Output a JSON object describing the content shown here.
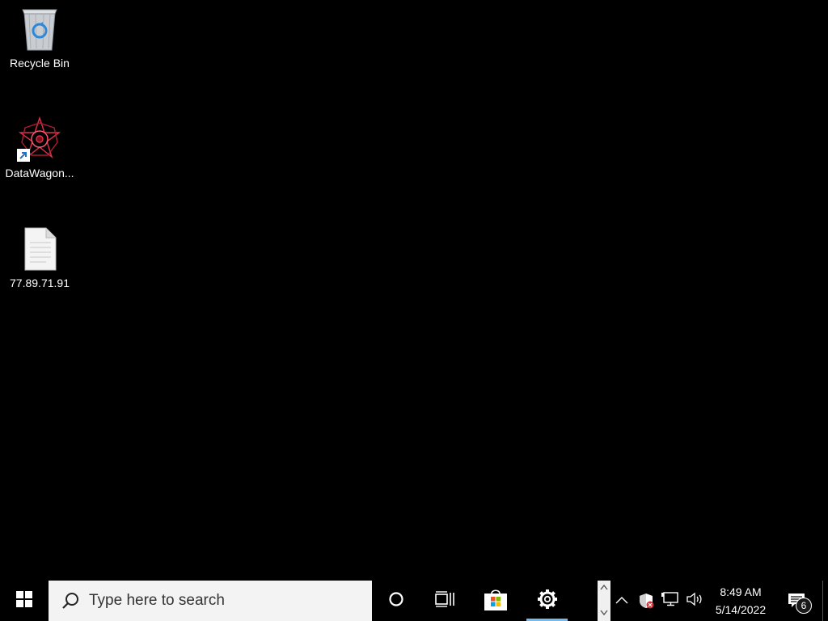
{
  "desktop": {
    "icons": [
      {
        "label": "Recycle Bin",
        "icon": "recycle-bin-icon"
      },
      {
        "label": "DataWagon...",
        "icon": "datawagon-app-icon"
      },
      {
        "label": "77.89.71.91",
        "icon": "text-file-icon"
      }
    ]
  },
  "taskbar": {
    "start_icon": "windows-logo-icon",
    "search_placeholder": "Type here to search",
    "pinned": [
      {
        "name": "Cortana",
        "icon": "cortana-circle-icon"
      },
      {
        "name": "Task View",
        "icon": "task-view-icon"
      },
      {
        "name": "Microsoft Store",
        "icon": "store-icon"
      },
      {
        "name": "Settings",
        "icon": "gear-icon",
        "active": true
      }
    ],
    "tray": {
      "icons": [
        "chevron-up-icon",
        "security-shield-icon",
        "network-icon",
        "volume-icon"
      ],
      "time": "8:49 AM",
      "date": "5/14/2022",
      "notification_count": "6"
    }
  },
  "colors": {
    "background": "#000000",
    "accent": "#76b9ed",
    "search_bg": "#f3f3f3"
  }
}
